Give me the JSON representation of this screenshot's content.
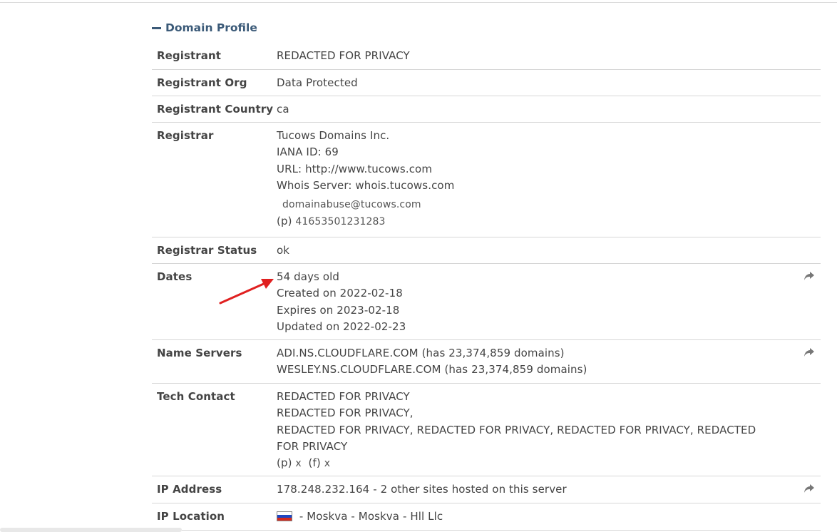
{
  "section": {
    "title": "Domain Profile",
    "collapse_icon": "minus-icon"
  },
  "rows": {
    "registrant": {
      "label": "Registrant",
      "value": "REDACTED FOR PRIVACY"
    },
    "registrant_org": {
      "label": "Registrant Org",
      "value": "Data Protected"
    },
    "registrant_country": {
      "label": "Registrant Country",
      "value": "ca"
    },
    "registrar": {
      "label": "Registrar",
      "name": "Tucows Domains Inc.",
      "iana": "IANA ID: 69",
      "url": "URL: http://www.tucows.com",
      "whois": "Whois Server: whois.tucows.com",
      "email": "domainabuse@tucows.com",
      "phone_prefix": "(p)",
      "phone": "41653501231283"
    },
    "registrar_status": {
      "label": "Registrar Status",
      "value": "ok"
    },
    "dates": {
      "label": "Dates",
      "age": "54 days old",
      "created": "Created on 2022-02-18",
      "expires": "Expires on 2023-02-18",
      "updated": "Updated on 2022-02-23",
      "share_icon": "share-arrow-icon"
    },
    "name_servers": {
      "label": "Name Servers",
      "ns1": "ADI.NS.CLOUDFLARE.COM (has 23,374,859 domains)",
      "ns2": "WESLEY.NS.CLOUDFLARE.COM (has 23,374,859 domains)",
      "share_icon": "share-arrow-icon"
    },
    "tech_contact": {
      "label": "Tech Contact",
      "line1": "REDACTED FOR PRIVACY",
      "line2": "REDACTED FOR PRIVACY,",
      "line3": "REDACTED FOR PRIVACY, REDACTED FOR PRIVACY, REDACTED FOR PRIVACY, REDACTED",
      "line4": "FOR PRIVACY",
      "phone_prefix": "(p)",
      "phone": "x",
      "fax_prefix": "(f)",
      "fax": "x"
    },
    "ip_address": {
      "label": "IP Address",
      "value": "178.248.232.164 - 2 other sites hosted on this server",
      "share_icon": "share-arrow-icon"
    },
    "ip_location": {
      "label": "IP Location",
      "flag": "russia-flag-icon",
      "value": " - Moskva - Moskva - Hll Llc"
    }
  },
  "colors": {
    "header": "#3b5a78",
    "text": "#444444",
    "annotation_arrow": "#e02020",
    "divider": "#d6d6d6"
  }
}
